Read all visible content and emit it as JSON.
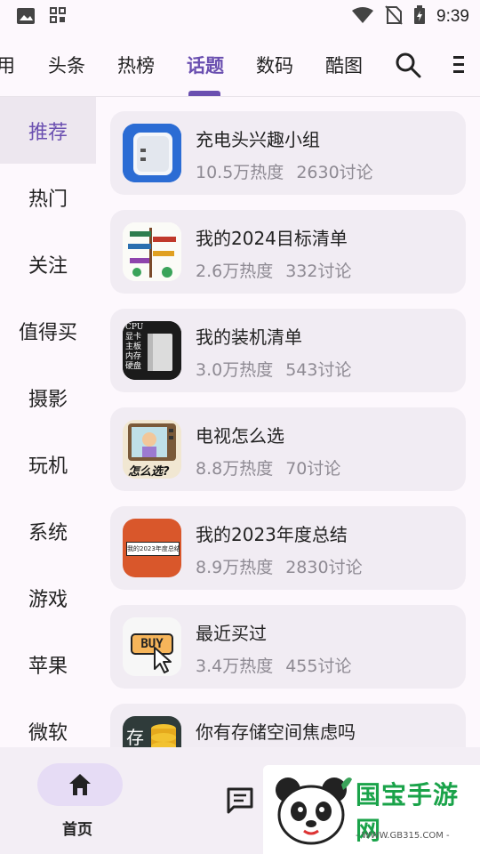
{
  "status_bar": {
    "time": "9:39"
  },
  "top_tabs": {
    "items": [
      "用",
      "头条",
      "热榜",
      "话题",
      "数码",
      "酷图"
    ],
    "active_index": 3
  },
  "sidebar": {
    "items": [
      "推荐",
      "热门",
      "关注",
      "值得买",
      "摄影",
      "玩机",
      "系统",
      "游戏",
      "苹果",
      "微软"
    ],
    "active_index": 0
  },
  "topics": [
    {
      "title": "充电头兴趣小组",
      "heat": "10.5万热度",
      "discussions": "2630讨论"
    },
    {
      "title": "我的2024目标清单",
      "heat": "2.6万热度",
      "discussions": "332讨论"
    },
    {
      "title": "我的装机清单",
      "heat": "3.0万热度",
      "discussions": "543讨论"
    },
    {
      "title": "电视怎么选",
      "heat": "8.8万热度",
      "discussions": "70讨论"
    },
    {
      "title": "我的2023年度总结",
      "heat": "8.9万热度",
      "discussions": "2830讨论"
    },
    {
      "title": "最近买过",
      "heat": "3.4万热度",
      "discussions": "455讨论"
    },
    {
      "title": "你有存储空间焦虑吗",
      "heat": "",
      "discussions": ""
    }
  ],
  "thumb_text": {
    "pc_lines": [
      "CPU",
      "显卡",
      "主板",
      "内存",
      "硬盘"
    ],
    "tv_caption": "怎么选?",
    "summary_banner": "我的2023年度总结",
    "buy": "BUY",
    "storage": "存"
  },
  "bottom_nav": {
    "home_label": "首页"
  },
  "watermark": {
    "name": "国宝手游网",
    "url": "- WWW.GB315.COM -"
  },
  "icons": [
    "image-icon",
    "grid-icon",
    "wifi-icon",
    "no-sim-icon",
    "battery-icon",
    "search-icon",
    "menu-icon",
    "home-icon",
    "message-icon"
  ],
  "colors": {
    "accent": "#6a4fb0",
    "card_bg": "#f1ecf3",
    "meta_text": "#8e8a93"
  }
}
